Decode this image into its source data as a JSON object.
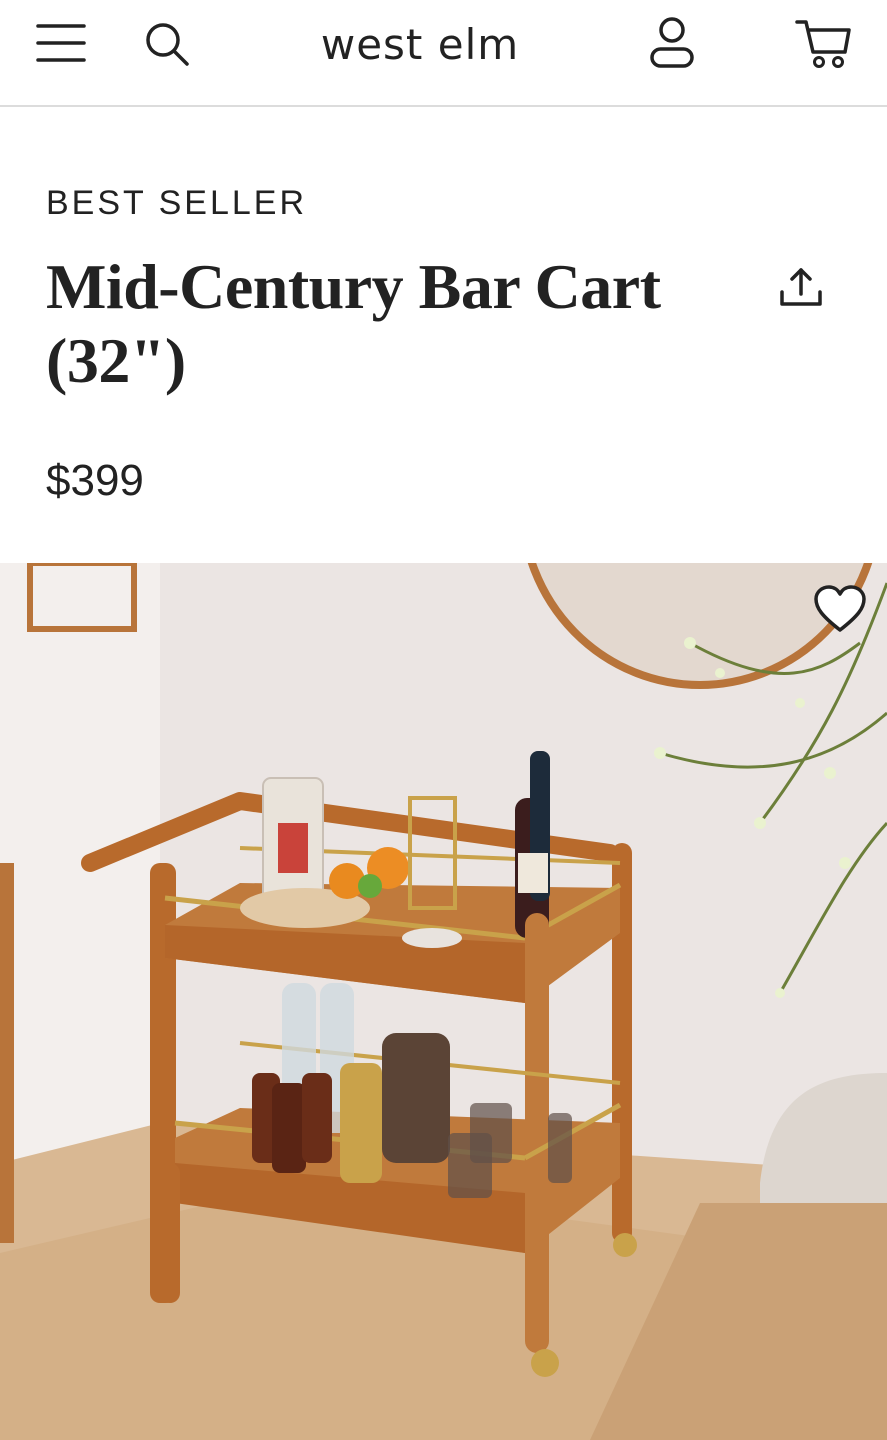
{
  "header": {
    "logo": "west elm",
    "icons": {
      "menu": "hamburger-menu-icon",
      "search": "search-icon",
      "account": "user-account-icon",
      "cart": "shopping-cart-icon"
    }
  },
  "product": {
    "badge": "BEST SELLER",
    "title": "Mid-Century Bar Cart (32\")",
    "price": "$399",
    "share_icon": "share-icon",
    "favorite_icon": "heart-icon"
  },
  "colors": {
    "text": "#222222",
    "divider": "#dcdcdc",
    "wood": "#b96a2c",
    "brass": "#c9a24a",
    "wall": "#ece6e4",
    "floor": "#d8b48d"
  }
}
